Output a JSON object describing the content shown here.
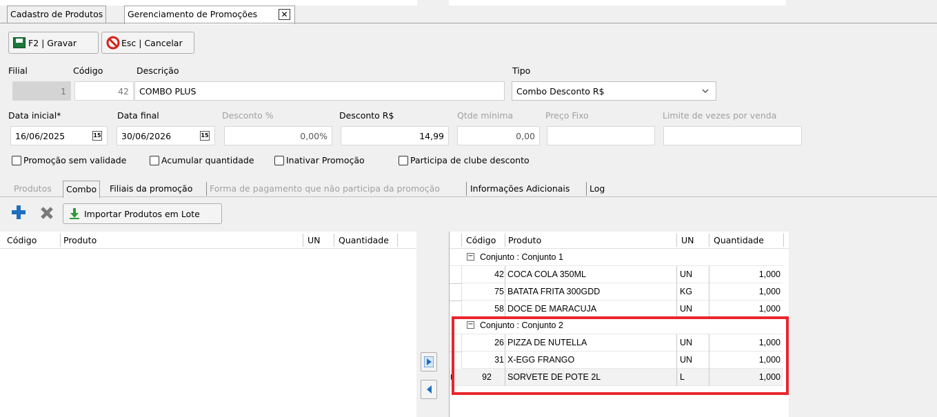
{
  "tabs": {
    "first": "Cadastro de Produtos",
    "second": "Gerenciamento de Promoções",
    "close": "✕"
  },
  "toolbar": {
    "save_label": "F2 | Gravar",
    "cancel_label": "Esc | Cancelar"
  },
  "form": {
    "filial_label": "Filial",
    "filial_value": "1",
    "codigo_label": "Código",
    "codigo_value": "42",
    "descricao_label": "Descrição",
    "descricao_value": "COMBO PLUS",
    "tipo_label": "Tipo",
    "tipo_value": "Combo Desconto R$",
    "data_inicial_label": "Data inicial*",
    "data_inicial_value": "16/06/2025",
    "data_final_label": "Data final",
    "data_final_value": "30/06/2026",
    "desconto_pct_label": "Desconto %",
    "desconto_pct_value": "0,00%",
    "desconto_rs_label": "Desconto R$",
    "desconto_rs_value": "14,99",
    "qtde_min_label": "Qtde mínima",
    "qtde_min_value": "0,00",
    "preco_fixo_label": "Preço Fixo",
    "limite_label": "Limite de vezes por venda",
    "cal_icon": "15"
  },
  "checks": [
    "Promoção sem validade",
    "Acumular quantidade",
    "Inativar Promoção",
    "Participa de clube desconto"
  ],
  "subtabs": [
    "Produtos",
    "Combo",
    "Filiais da promoção",
    "Forma de pagamento que não participa da promoção",
    "Informações Adicionais",
    "Log"
  ],
  "combo_toolbar": {
    "import_label": "Importar Produtos em Lote"
  },
  "left_grid": {
    "headers": [
      "Código",
      "Produto",
      "UN",
      "Quantidade"
    ]
  },
  "right_grid": {
    "headers": [
      "Código",
      "Produto",
      "UN",
      "Quantidade"
    ],
    "group1": "Conjunto : Conjunto 1",
    "group2": "Conjunto : Conjunto 2",
    "group_toggle": "−",
    "rows": [
      {
        "code": "42",
        "product": "COCA COLA 350ML",
        "un": "UN",
        "qty": "1,000"
      },
      {
        "code": "75",
        "product": "BATATA FRITA 300GDD",
        "un": "KG",
        "qty": "1,000"
      },
      {
        "code": "58",
        "product": "DOCE DE MARACUJA",
        "un": "UN",
        "qty": "1,000"
      },
      {
        "code": "26",
        "product": "PIZZA DE NUTELLA",
        "un": "UN",
        "qty": "1,000"
      },
      {
        "code": "31",
        "product": "X-EGG FRANGO",
        "un": "UN",
        "qty": "1,000"
      },
      {
        "code": "92",
        "product": "SORVETE DE POTE 2L",
        "un": "L",
        "qty": "1,000"
      }
    ]
  },
  "colors": {
    "highlight": "#e8262d",
    "accent_blue": "#1e6fc0"
  },
  "icons": [
    "save-icon",
    "cancel-icon",
    "add-icon",
    "delete-icon",
    "import-icon",
    "arrow-right-icon",
    "arrow-left-icon",
    "calendar-icon",
    "chevron-down-icon",
    "close-icon"
  ]
}
